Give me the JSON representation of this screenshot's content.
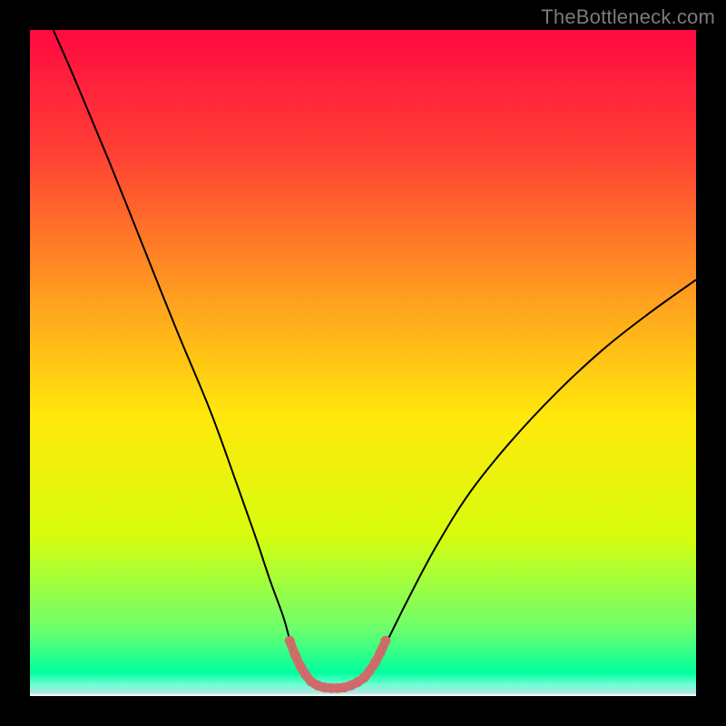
{
  "watermark": {
    "text": "TheBottleneck.com"
  },
  "plot": {
    "inner_x": 33,
    "inner_y": 33,
    "inner_w": 734,
    "inner_h": 734
  },
  "chart_data": {
    "type": "line",
    "title": "",
    "xlabel": "",
    "ylabel": "",
    "xlim": [
      0,
      100
    ],
    "ylim": [
      0,
      100
    ],
    "gradient_stops": [
      {
        "t": 0.0,
        "c": "#ff0a41"
      },
      {
        "t": 0.18,
        "c": "#ff3e34"
      },
      {
        "t": 0.4,
        "c": "#ff9e1f"
      },
      {
        "t": 0.58,
        "c": "#ffe80b"
      },
      {
        "t": 0.76,
        "c": "#d6fd0e"
      },
      {
        "t": 0.9,
        "c": "#6cff6d"
      },
      {
        "t": 0.965,
        "c": "#00ff9e"
      },
      {
        "t": 0.982,
        "c": "#67ffd1"
      },
      {
        "t": 0.995,
        "c": "#aee7e0"
      },
      {
        "t": 1.0,
        "c": "#ffffff"
      }
    ],
    "series": [
      {
        "name": "bottleneck-curve",
        "color": "#000000",
        "width": 2,
        "points": [
          {
            "x": 3.5,
            "y": 100.0
          },
          {
            "x": 7.0,
            "y": 92.0
          },
          {
            "x": 12.0,
            "y": 80.0
          },
          {
            "x": 17.0,
            "y": 67.5
          },
          {
            "x": 22.0,
            "y": 55.0
          },
          {
            "x": 27.0,
            "y": 43.0
          },
          {
            "x": 31.0,
            "y": 32.0
          },
          {
            "x": 34.0,
            "y": 23.5
          },
          {
            "x": 36.0,
            "y": 17.5
          },
          {
            "x": 38.0,
            "y": 12.0
          },
          {
            "x": 39.0,
            "y": 8.5
          },
          {
            "x": 40.0,
            "y": 5.5
          },
          {
            "x": 41.5,
            "y": 2.8
          },
          {
            "x": 43.0,
            "y": 1.6
          },
          {
            "x": 45.0,
            "y": 1.2
          },
          {
            "x": 47.0,
            "y": 1.2
          },
          {
            "x": 49.0,
            "y": 1.6
          },
          {
            "x": 50.5,
            "y": 2.8
          },
          {
            "x": 52.0,
            "y": 5.0
          },
          {
            "x": 54.0,
            "y": 9.0
          },
          {
            "x": 57.0,
            "y": 15.0
          },
          {
            "x": 61.0,
            "y": 22.5
          },
          {
            "x": 66.0,
            "y": 30.5
          },
          {
            "x": 72.0,
            "y": 38.0
          },
          {
            "x": 79.0,
            "y": 45.5
          },
          {
            "x": 86.0,
            "y": 52.0
          },
          {
            "x": 93.0,
            "y": 57.5
          },
          {
            "x": 100.0,
            "y": 62.5
          }
        ]
      },
      {
        "name": "valley-highlight",
        "color": "#d06a6a",
        "width": 10,
        "dots": true,
        "points": [
          {
            "x": 39.0,
            "y": 8.3
          },
          {
            "x": 39.8,
            "y": 6.2
          },
          {
            "x": 40.6,
            "y": 4.5
          },
          {
            "x": 41.4,
            "y": 3.2
          },
          {
            "x": 42.2,
            "y": 2.2
          },
          {
            "x": 43.2,
            "y": 1.6
          },
          {
            "x": 44.2,
            "y": 1.3
          },
          {
            "x": 45.2,
            "y": 1.2
          },
          {
            "x": 46.2,
            "y": 1.2
          },
          {
            "x": 47.2,
            "y": 1.3
          },
          {
            "x": 48.2,
            "y": 1.6
          },
          {
            "x": 49.2,
            "y": 2.1
          },
          {
            "x": 50.2,
            "y": 2.8
          },
          {
            "x": 51.0,
            "y": 3.8
          },
          {
            "x": 51.8,
            "y": 5.0
          },
          {
            "x": 52.6,
            "y": 6.5
          },
          {
            "x": 53.4,
            "y": 8.3
          }
        ]
      }
    ]
  }
}
